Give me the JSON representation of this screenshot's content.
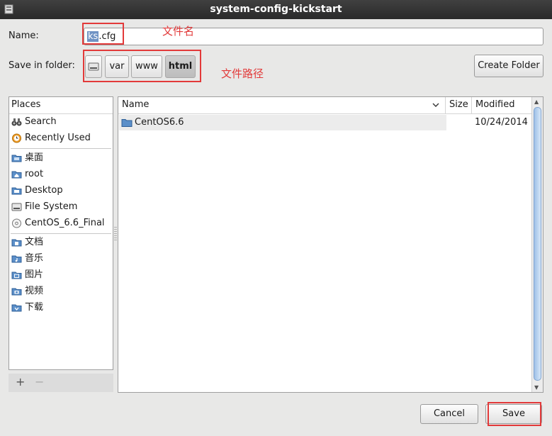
{
  "window": {
    "title": "system-config-kickstart"
  },
  "name_field": {
    "label": "Name:",
    "value_selected": "ks",
    "value_rest": ".cfg"
  },
  "save_in": {
    "label": "Save in folder:",
    "crumbs": [
      {
        "label": "",
        "icon": "drive-icon"
      },
      {
        "label": "var"
      },
      {
        "label": "www"
      },
      {
        "label": "html",
        "active": true
      }
    ],
    "create_folder_label": "Create Folder"
  },
  "annotations": {
    "filename": "文件名",
    "path": "文件路径",
    "color": "#e23a3a"
  },
  "places": {
    "header": "Places",
    "items": [
      {
        "label": "Search",
        "icon": "binoculars-icon"
      },
      {
        "label": "Recently Used",
        "icon": "clock-icon"
      },
      {
        "label": "桌面",
        "icon": "folder-icon"
      },
      {
        "label": "root",
        "icon": "home-folder-icon"
      },
      {
        "label": "Desktop",
        "icon": "desktop-folder-icon"
      },
      {
        "label": "File System",
        "icon": "drive-icon"
      },
      {
        "label": "CentOS_6.6_Final",
        "icon": "disc-icon"
      },
      {
        "label": "文档",
        "icon": "documents-folder-icon"
      },
      {
        "label": "音乐",
        "icon": "music-folder-icon"
      },
      {
        "label": "图片",
        "icon": "pictures-folder-icon"
      },
      {
        "label": "视频",
        "icon": "videos-folder-icon"
      },
      {
        "label": "下载",
        "icon": "downloads-folder-icon"
      }
    ],
    "add_label": "+",
    "remove_label": "−"
  },
  "files": {
    "columns": {
      "name": "Name",
      "size": "Size",
      "modified": "Modified"
    },
    "rows": [
      {
        "name": "CentOS6.6",
        "size": "",
        "modified": "10/24/2014",
        "icon": "folder-icon"
      }
    ]
  },
  "actions": {
    "cancel_label": "Cancel",
    "save_label": "Save"
  },
  "colors": {
    "folder": "#5b8fc9",
    "selection": "#7093c4",
    "scroll_thumb": "#9fc1e8"
  }
}
